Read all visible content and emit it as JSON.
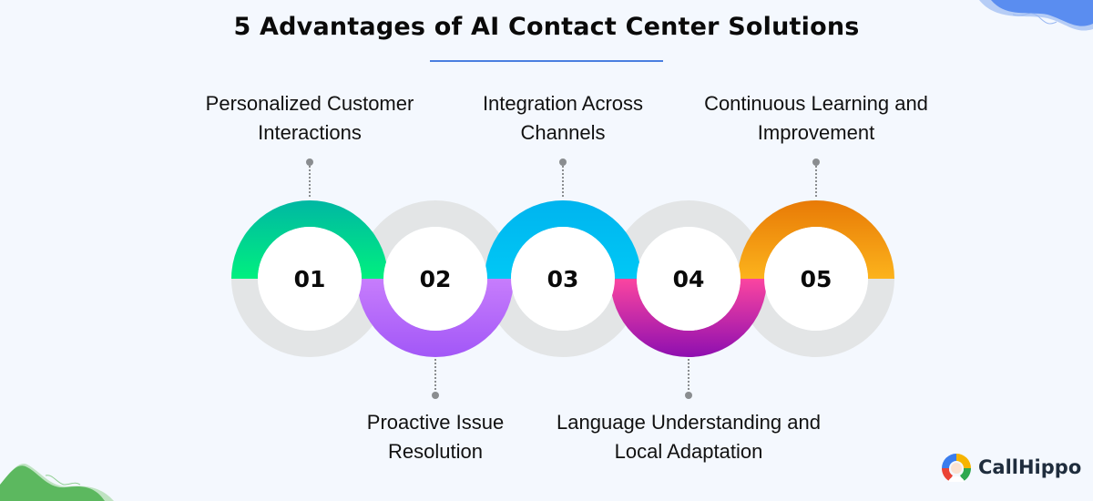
{
  "title": "5 Advantages of AI Contact Center Solutions",
  "accent_color": "#4a7fe0",
  "steps": [
    {
      "number": "01",
      "label_line1": "Personalized Customer",
      "label_line2": "Interactions",
      "position": "top",
      "color_start": "#00b7a3",
      "color_end": "#00f07f"
    },
    {
      "number": "02",
      "label_line1": "Proactive Issue",
      "label_line2": "Resolution",
      "position": "bottom",
      "color_start": "#c77dfc",
      "color_end": "#a257f7"
    },
    {
      "number": "03",
      "label_line1": "Integration Across",
      "label_line2": "Channels",
      "position": "top",
      "color_start": "#00b4ef",
      "color_end": "#00c8f5"
    },
    {
      "number": "04",
      "label_line1": "Language Understanding and",
      "label_line2": "Local Adaptation",
      "position": "bottom",
      "color_start": "#fb45a0",
      "color_end": "#8e0fb0"
    },
    {
      "number": "05",
      "label_line1": "Continuous Learning and",
      "label_line2": "Improvement",
      "position": "top",
      "color_start": "#e87a06",
      "color_end": "#fcb31c"
    }
  ],
  "brand": {
    "name": "CallHippo"
  }
}
